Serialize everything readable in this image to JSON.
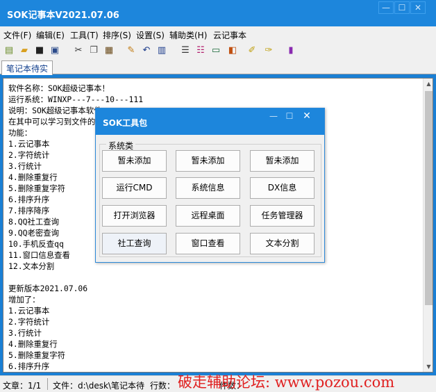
{
  "window": {
    "title": "SOK记事本V2021.07.06"
  },
  "menu": [
    "文件(F)",
    "编辑(E)",
    "工具(T)",
    "排序(S)",
    "设置(S)",
    "辅助类(H)",
    "云记事本"
  ],
  "toolbar_icons": [
    "new-file-icon",
    "open-folder-icon",
    "save-icon",
    "save-all-icon",
    "cut-icon",
    "copy-icon",
    "paste-icon",
    "edit-pen-icon",
    "undo-icon",
    "document-icon",
    "list-icon",
    "list-numbered-icon",
    "terminal-icon",
    "tag-icon",
    "highlight-icon",
    "highlight-clear-icon",
    "library-icon"
  ],
  "tab": {
    "label": "笔记本待实"
  },
  "editor": {
    "lines": [
      "软件名称：SOK超级记事本！",
      "运行系统：WINXP---7---10---111",
      "说明：SOK超级记事本软件",
      "在其中可以学习到文件的",
      "功能：",
      "1.云记事本",
      "2.字符统计",
      "3.行统计",
      "4.删除重复行",
      "5.删除重复字符",
      "6.排序升序",
      "7.排序降序",
      "8.QQ社工查询",
      "9.QQ老密查询",
      "10.手机反查qq",
      "11.窗口信息查看",
      "12.文本分割",
      "",
      "更新版本2021.07.06",
      "增加了：",
      "1.云记事本",
      "2.字符统计",
      "3.行统计",
      "4.删除重复行",
      "5.删除重复字符",
      "6.排序升序"
    ]
  },
  "status": {
    "line": "文章：1/1",
    "file": "文件：d:\\desk\\笔记本待",
    "rows": "行数：",
    "extra": "件数："
  },
  "watermark": "破走辅助论坛: www.pozou.com",
  "dialog": {
    "title": "SOK工具包",
    "group_label": "系统类",
    "buttons": [
      [
        "暂未添加",
        "暂未添加",
        "暂未添加"
      ],
      [
        "运行CMD",
        "系统信息",
        "DX信息"
      ],
      [
        "打开浏览器",
        "远程桌面",
        "任务管理器"
      ],
      [
        "社工查询",
        "窗口查看",
        "文本分割"
      ]
    ]
  }
}
